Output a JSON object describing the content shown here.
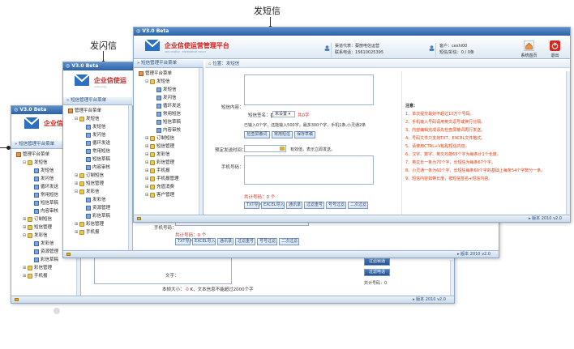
{
  "captions": {
    "sms": "发短信",
    "flash": "发闪信"
  },
  "version": "V3.0 Beta",
  "brand": "企业信使运营管理平台",
  "brand_sub": "SMS MOBILE · ENTERPRISE TRUST",
  "brand_mid": "企业信使运",
  "brand_mid_sub": "enterprise",
  "brand_short": "企业信",
  "menu_header": "短信管理平台菜单",
  "header": {
    "agent_code_label": "渠道代表：",
    "agent_code_value": "蔡丽电信运营",
    "contact_label": "联系电话：",
    "contact_value": "15610025395",
    "client_label": "客户：",
    "client_value": "ceshi00",
    "balance_label": "短信/彩信：",
    "balance_value": "0 / 0条",
    "home_label": "系统首页",
    "exit_label": "退出"
  },
  "breadcrumb": {
    "label": "位置：",
    "value": "发短信"
  },
  "win_main": {
    "tree": [
      {
        "lvl": 0,
        "icon": "home",
        "pm": "",
        "label": "管理平台菜单"
      },
      {
        "lvl": 1,
        "icon": "folder",
        "pm": "⊟",
        "label": "发短信"
      },
      {
        "lvl": 2,
        "icon": "leaf",
        "pm": "",
        "label": "发短信"
      },
      {
        "lvl": 2,
        "icon": "leaf",
        "pm": "",
        "label": "发闪信"
      },
      {
        "lvl": 2,
        "icon": "leaf",
        "pm": "",
        "label": "循环发送"
      },
      {
        "lvl": 2,
        "icon": "leaf",
        "pm": "",
        "label": "常用短信"
      },
      {
        "lvl": 2,
        "icon": "leaf",
        "pm": "",
        "label": "短信草稿"
      },
      {
        "lvl": 2,
        "icon": "leaf",
        "pm": "",
        "label": "内容审核"
      },
      {
        "lvl": 1,
        "icon": "folder",
        "pm": "⊞",
        "label": "订制短信"
      },
      {
        "lvl": 1,
        "icon": "folder",
        "pm": "⊞",
        "label": "短信管理"
      },
      {
        "lvl": 1,
        "icon": "folder",
        "pm": "⊞",
        "label": "发彩信"
      },
      {
        "lvl": 1,
        "icon": "folder",
        "pm": "⊞",
        "label": "彩信管理"
      },
      {
        "lvl": 1,
        "icon": "folder",
        "pm": "⊞",
        "label": "手机报"
      },
      {
        "lvl": 1,
        "icon": "folder",
        "pm": "⊞",
        "label": "手机报管理"
      },
      {
        "lvl": 1,
        "icon": "folder",
        "pm": "⊞",
        "label": "充值消费"
      },
      {
        "lvl": 1,
        "icon": "folder",
        "pm": "⊞",
        "label": "客户管理"
      }
    ],
    "form": {
      "content_label": "短信内容：",
      "sign_label": "短信签名：",
      "sign_select": "未设置",
      "sign_count": "共0字",
      "stats": "已输入0个字，还能输入500字，最多300个字，手机1条,小灵通2条",
      "btn_check": "检查屏蔽词",
      "btn_common": "常用短信",
      "btn_save": "保存草稿",
      "timer_label": "预定发送时间：",
      "timer_hint": "有效值，表示立即发送。",
      "phone_label": "手机号码：",
      "total": "共计号码：0 个",
      "btns": [
        "TXT导入",
        "EXCEL导入",
        "通讯录",
        "过滤重号",
        "号号过滤",
        "二次过滤"
      ]
    },
    "notes": {
      "title": "注意：",
      "items": [
        "1、单次提交最好不超过10万个号码。",
        "2、手机输入号码请用英文逗号或换行分隔。",
        "3、内容编辑完成请先检查屏蔽词再行发送。",
        "4、号码文件只支持TXT、EXCEL文件格式。",
        "5、请使用CTRL+V粘贴短信内容。",
        "6、汉字、数字、英文均按65个字为每条计1个长度。",
        "7、英文长一条为70个字，长短信为每条67个字。",
        "8、小灵通一条为60个字，长短信每条60个字的基础上每条54个字数分一条。",
        "9、短信内容如带长度，按短信签名+短信内容。"
      ]
    },
    "status": "▸ 版本 2010 v2.0"
  },
  "win_mid": {
    "tree": [
      {
        "lvl": 0,
        "icon": "home",
        "pm": "",
        "label": "管理平台菜单"
      },
      {
        "lvl": 1,
        "icon": "folder",
        "pm": "⊟",
        "label": "发短信"
      },
      {
        "lvl": 2,
        "icon": "leaf",
        "pm": "",
        "label": "发短信"
      },
      {
        "lvl": 2,
        "icon": "leaf",
        "pm": "",
        "label": "发闪信"
      },
      {
        "lvl": 2,
        "icon": "leaf",
        "pm": "",
        "label": "循环发送"
      },
      {
        "lvl": 2,
        "icon": "leaf",
        "pm": "",
        "label": "常用短信"
      },
      {
        "lvl": 2,
        "icon": "leaf",
        "pm": "",
        "label": "短信草稿"
      },
      {
        "lvl": 2,
        "icon": "leaf",
        "pm": "",
        "label": "内容审核"
      },
      {
        "lvl": 1,
        "icon": "folder",
        "pm": "⊞",
        "label": "订制短信"
      },
      {
        "lvl": 1,
        "icon": "folder",
        "pm": "⊞",
        "label": "短信管理"
      },
      {
        "lvl": 1,
        "icon": "folder",
        "pm": "⊟",
        "label": "发彩信"
      },
      {
        "lvl": 2,
        "icon": "leaf",
        "pm": "",
        "label": "发彩信"
      },
      {
        "lvl": 2,
        "icon": "leaf",
        "pm": "",
        "label": "资源管理"
      },
      {
        "lvl": 2,
        "icon": "leaf",
        "pm": "",
        "label": "彩信草稿"
      },
      {
        "lvl": 1,
        "icon": "folder",
        "pm": "⊞",
        "label": "彩信管理"
      },
      {
        "lvl": 1,
        "icon": "folder",
        "pm": "⊞",
        "label": "手机报"
      }
    ],
    "phone_label": "手机号码：",
    "total": "共计号码：0 个",
    "btns": [
      "TXT导入",
      "EXCEL导入",
      "通讯录",
      "过滤重号",
      "号号过滤",
      "二次过滤"
    ],
    "status": "▸ 版本 2010 v2.0"
  },
  "win_back": {
    "tree": [
      {
        "lvl": 0,
        "icon": "home",
        "pm": "",
        "label": "管理平台菜单"
      },
      {
        "lvl": 1,
        "icon": "folder",
        "pm": "⊟",
        "label": "发短信"
      },
      {
        "lvl": 2,
        "icon": "leaf",
        "pm": "",
        "label": "发短信"
      },
      {
        "lvl": 2,
        "icon": "leaf",
        "pm": "",
        "label": "发闪信"
      },
      {
        "lvl": 2,
        "icon": "leaf",
        "pm": "",
        "label": "循环发送"
      },
      {
        "lvl": 2,
        "icon": "leaf",
        "pm": "",
        "label": "常用短信"
      },
      {
        "lvl": 2,
        "icon": "leaf",
        "pm": "",
        "label": "短信草稿"
      },
      {
        "lvl": 2,
        "icon": "leaf",
        "pm": "",
        "label": "内容审核"
      },
      {
        "lvl": 1,
        "icon": "folder",
        "pm": "⊞",
        "label": "订制短信"
      },
      {
        "lvl": 1,
        "icon": "folder",
        "pm": "⊞",
        "label": "短信管理"
      },
      {
        "lvl": 1,
        "icon": "folder",
        "pm": "⊟",
        "label": "发彩信"
      },
      {
        "lvl": 2,
        "icon": "leaf",
        "pm": "",
        "label": "发彩信"
      },
      {
        "lvl": 2,
        "icon": "leaf",
        "pm": "",
        "label": "资源管理"
      },
      {
        "lvl": 2,
        "icon": "leaf",
        "pm": "",
        "label": "彩信草稿"
      },
      {
        "lvl": 1,
        "icon": "folder",
        "pm": "⊞",
        "label": "彩信管理"
      },
      {
        "lvl": 1,
        "icon": "folder",
        "pm": "⊞",
        "label": "手机报"
      }
    ],
    "text_label": "文字：",
    "size_label": "本帧大小：",
    "size_value": "0",
    "size_note": "K，文本信息不能超过2000个字",
    "btn_filter1": "过滤帧通",
    "btn_filter2": "过滤电话",
    "total_side": "共计号码：0",
    "status": "▸ 版本 2010 v2.0"
  }
}
